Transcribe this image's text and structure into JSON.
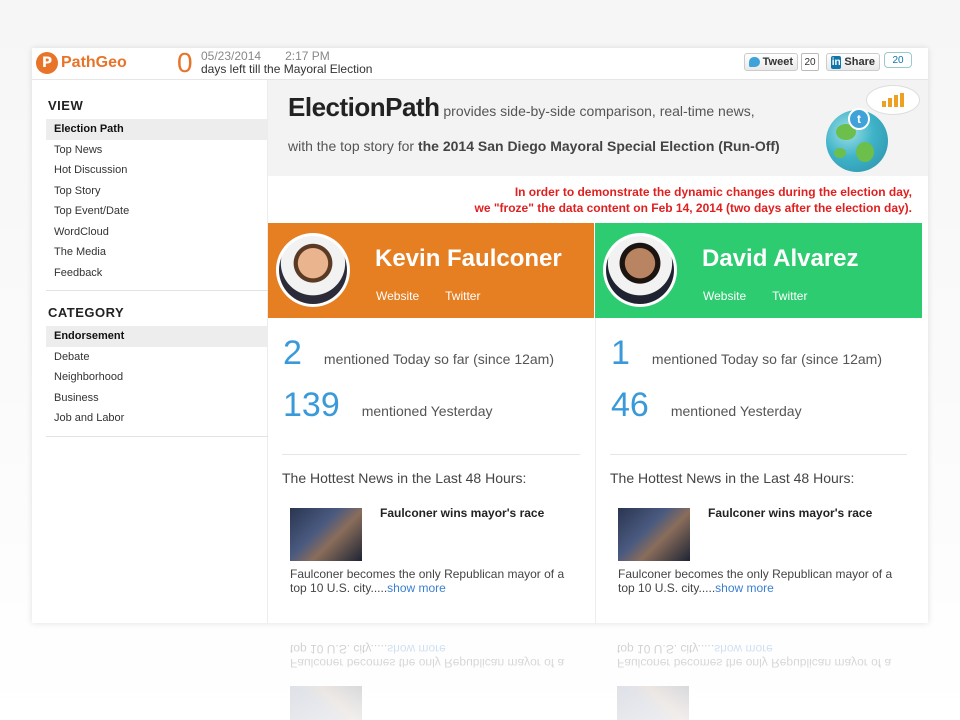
{
  "topbar": {
    "logo_mark": "P",
    "logo_text": "PathGeo",
    "countdown": "0",
    "date": "05/23/2014",
    "time": "2:17 PM",
    "days_left_text": "days left till the Mayoral Election",
    "tweet_label": "Tweet",
    "tweet_count": "20",
    "share_label": "Share",
    "share_count": "20"
  },
  "sidebar": {
    "view_heading": "VIEW",
    "view_items": [
      "Election Path",
      "Top News",
      "Hot Discussion",
      "Top Story",
      "Top Event/Date",
      "WordCloud",
      "The Media",
      "Feedback"
    ],
    "category_heading": "CATEGORY",
    "category_items": [
      "Endorsement",
      "Debate",
      "Neighborhood",
      "Business",
      "Job and Labor"
    ]
  },
  "intro": {
    "brand": "ElectionPath",
    "line1_rest": " provides side-by-side comparison, real-time news,",
    "line2_prefix": "with the top story for ",
    "line2_bold": "the 2014 San Diego Mayoral Special Election (Run-Off)"
  },
  "notice": {
    "line1": "In order to demonstrate the dynamic changes during the election day,",
    "line2": "we \"froze\" the data content on Feb 14, 2014 (two days after the election day)."
  },
  "candidates": [
    {
      "name": "Kevin Faulconer",
      "website": "Website",
      "twitter": "Twitter",
      "today_count": "2",
      "today_label": "mentioned Today so far (since 12am)",
      "yesterday_count": "139",
      "yesterday_label": "mentioned Yesterday",
      "hot_title": "The Hottest News in the Last 48 Hours:",
      "news_title": "Faulconer wins mayor's race",
      "news_body": "Faulconer becomes the only Republican mayor of a top 10 U.S. city.....",
      "show_more": "show more"
    },
    {
      "name": "David Alvarez",
      "website": "Website",
      "twitter": "Twitter",
      "today_count": "1",
      "today_label": "mentioned Today so far (since 12am)",
      "yesterday_count": "46",
      "yesterday_label": "mentioned Yesterday",
      "hot_title": "The Hottest News in the Last 48 Hours:",
      "news_title": "Faulconer wins mayor's race",
      "news_body": "Faulconer becomes the only Republican mayor of a top 10 U.S. city.....",
      "show_more": "show more"
    }
  ],
  "colors": {
    "brand_orange": "#e67e22",
    "green": "#2ecc71",
    "stat_blue": "#3a9ad9",
    "notice_red": "#e02020"
  }
}
